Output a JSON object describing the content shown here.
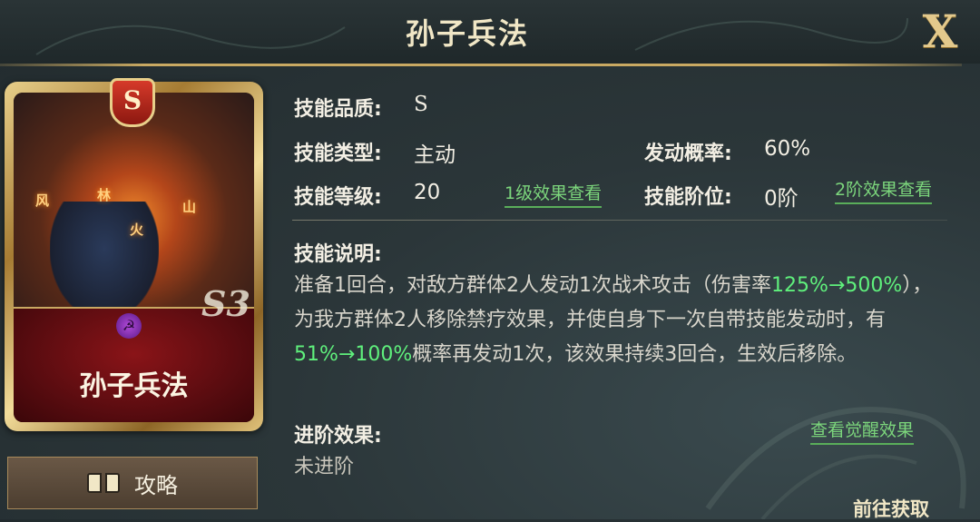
{
  "header": {
    "title": "孙子兵法",
    "close_label": "X"
  },
  "card": {
    "grade": "S",
    "name": "孙子兵法",
    "season_mark": "S3",
    "glyphs": [
      "风",
      "林",
      "火",
      "山"
    ]
  },
  "guide_button": {
    "label": "攻略",
    "icon": "book-icon"
  },
  "info": {
    "quality_label": "技能品质:",
    "quality_value": "S",
    "type_label": "技能类型:",
    "type_value": "主动",
    "chance_label": "发动概率:",
    "chance_value": "60%",
    "level_label": "技能等级:",
    "level_value": "20",
    "level_link": "1级效果查看",
    "rank_label": "技能阶位:",
    "rank_value": "0阶",
    "rank_link": "2阶效果查看",
    "desc_label": "技能说明:",
    "desc_parts": [
      "准备1回合，对敌方群体2人发动1次战术攻击（伤害率",
      "125%→500%",
      "），为我方群体2人移除禁疗效果，并使自身下一次自带技能发动时，有",
      "51%→100%",
      "概率再发动1次，该效果持续3回合，生效后移除。"
    ],
    "advance_label": "进阶效果:",
    "advance_link": "查看觉醒效果",
    "advance_value": "未进阶",
    "goto_label": "前往获取"
  },
  "colors": {
    "highlight": "#5ff07c",
    "link": "#7cd67c",
    "gold": "#c9a962",
    "card_red": "#8a1418"
  }
}
